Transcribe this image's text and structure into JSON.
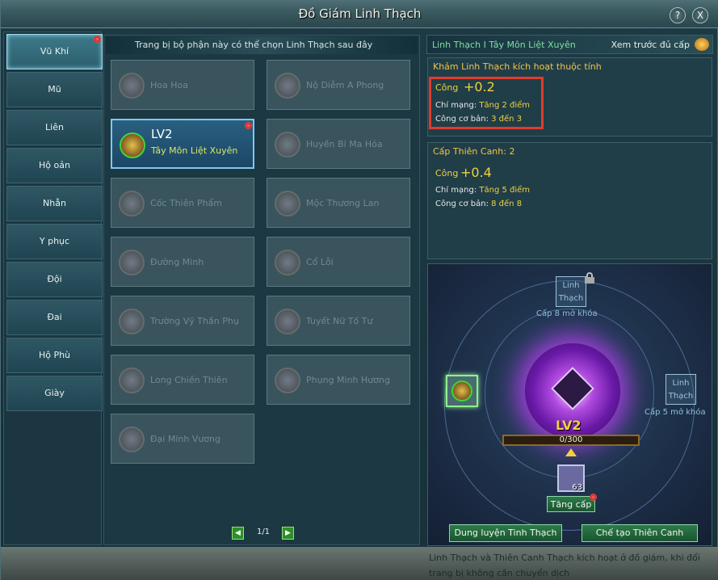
{
  "window": {
    "title": "Đồ Giám Linh Thạch",
    "help": "?",
    "close": "X"
  },
  "tabs": [
    {
      "label": "Vũ Khí",
      "active": true,
      "dot": true
    },
    {
      "label": "Mũ"
    },
    {
      "label": "Liên"
    },
    {
      "label": "Hộ oản"
    },
    {
      "label": "Nhẫn"
    },
    {
      "label": "Y phục"
    },
    {
      "label": "Đội"
    },
    {
      "label": "Đai"
    },
    {
      "label": "Hộ Phù"
    },
    {
      "label": "Giày"
    }
  ],
  "middle": {
    "header": "Trang bị bộ phận này có thể chọn Linh Thạch sau đây",
    "cards": [
      {
        "name": "Hoa Hoa"
      },
      {
        "name": "Nộ Diễm A Phong"
      },
      {
        "name": "Tây Môn Liệt Xuyên",
        "level": "LV2",
        "selected": true
      },
      {
        "name": "Huyền Bí Ma Hóa"
      },
      {
        "name": "Cốc Thiên Phẩm"
      },
      {
        "name": "Mộc Thương Lan"
      },
      {
        "name": "Đường Minh"
      },
      {
        "name": "Cổ Lỗi"
      },
      {
        "name": "Trường Vỹ Thần Phụ"
      },
      {
        "name": "Tuyết Nữ Tố Tư"
      },
      {
        "name": "Long Chiến Thiên"
      },
      {
        "name": "Phụng Minh Hương"
      },
      {
        "name": "Đại Minh Vương"
      }
    ],
    "pager": {
      "prev": "◀",
      "page": "1/1",
      "next": "▶"
    }
  },
  "right": {
    "title": "Linh Thạch I Tây Môn Liệt Xuyên",
    "preview": "Xem trước đủ cấp",
    "box1": {
      "header": "Khảm Linh Thạch kích hoạt thuộc tính",
      "stat": "Công",
      "value": "+0.2",
      "line1_label": "Chí mạng:",
      "line1_value": "Tăng 2 điểm",
      "line2_label": "Công cơ bản:",
      "line2_value": "3 đến 3"
    },
    "box2": {
      "header": "Cấp Thiên Canh: 2",
      "stat": "Công",
      "value": "+0.4",
      "line1_label": "Chí mạng:",
      "line1_value": "Tăng 5 điểm",
      "line2_label": "Công cơ bản:",
      "line2_value": "8 đến 8"
    },
    "scene": {
      "slot_top": "Linh Thạch",
      "slot_top_caption": "Cấp 8 mở khóa",
      "slot_right": "Linh Thạch",
      "slot_right_caption": "Cấp 5 mở khóa",
      "level": "LV2",
      "exp": "0/300",
      "material_count": "63",
      "upgrade": "Tăng cấp"
    },
    "btn_refine": "Dung luyện Tinh Thạch",
    "btn_craft": "Chế tạo Thiên Canh Thạch"
  },
  "footer": "Linh Thạch và Thiên Canh Thạch kích hoạt ở đồ giám, khi đổi trang bị không cần chuyển dịch",
  "colors": {
    "accent": "#7ec8ee",
    "gold": "#f0d040",
    "highlight": "#e23b2a"
  }
}
